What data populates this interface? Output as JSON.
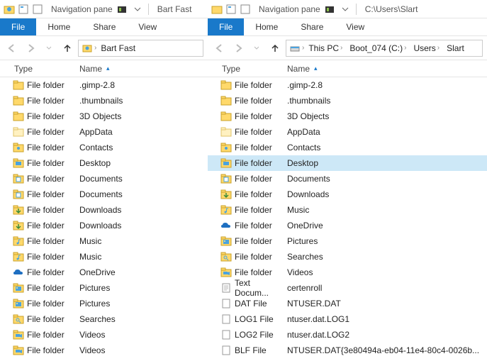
{
  "left": {
    "title_prefix": "Navigation pane",
    "title_path": "Bart Fast",
    "tabs": {
      "file": "File",
      "home": "Home",
      "share": "Share",
      "view": "View"
    },
    "breadcrumb": [
      "Bart Fast"
    ],
    "columns": {
      "type": "Type",
      "name": "Name"
    },
    "rows": [
      {
        "icon": "folder",
        "type": "File folder",
        "name": ".gimp-2.8"
      },
      {
        "icon": "folder",
        "type": "File folder",
        "name": ".thumbnails"
      },
      {
        "icon": "folder",
        "type": "File folder",
        "name": "3D Objects"
      },
      {
        "icon": "folder-light",
        "type": "File folder",
        "name": "AppData"
      },
      {
        "icon": "contacts",
        "type": "File folder",
        "name": "Contacts"
      },
      {
        "icon": "desktop",
        "type": "File folder",
        "name": "Desktop"
      },
      {
        "icon": "documents",
        "type": "File folder",
        "name": "Documents"
      },
      {
        "icon": "documents",
        "type": "File folder",
        "name": "Documents"
      },
      {
        "icon": "downloads",
        "type": "File folder",
        "name": "Downloads"
      },
      {
        "icon": "downloads",
        "type": "File folder",
        "name": "Downloads"
      },
      {
        "icon": "music",
        "type": "File folder",
        "name": "Music"
      },
      {
        "icon": "music",
        "type": "File folder",
        "name": "Music"
      },
      {
        "icon": "onedrive",
        "type": "File folder",
        "name": "OneDrive"
      },
      {
        "icon": "pictures",
        "type": "File folder",
        "name": "Pictures"
      },
      {
        "icon": "pictures",
        "type": "File folder",
        "name": "Pictures"
      },
      {
        "icon": "searches",
        "type": "File folder",
        "name": "Searches"
      },
      {
        "icon": "videos",
        "type": "File folder",
        "name": "Videos"
      },
      {
        "icon": "videos",
        "type": "File folder",
        "name": "Videos"
      }
    ]
  },
  "right": {
    "title_prefix": "Navigation pane",
    "title_path": "C:\\Users\\Slart",
    "tabs": {
      "file": "File",
      "home": "Home",
      "share": "Share",
      "view": "View"
    },
    "breadcrumb": [
      "This PC",
      "Boot_074 (C:)",
      "Users",
      "Slart"
    ],
    "columns": {
      "type": "Type",
      "name": "Name"
    },
    "selected_index": 5,
    "rows": [
      {
        "icon": "folder",
        "type": "File folder",
        "name": ".gimp-2.8"
      },
      {
        "icon": "folder",
        "type": "File folder",
        "name": ".thumbnails"
      },
      {
        "icon": "folder",
        "type": "File folder",
        "name": "3D Objects"
      },
      {
        "icon": "folder-light",
        "type": "File folder",
        "name": "AppData"
      },
      {
        "icon": "contacts",
        "type": "File folder",
        "name": "Contacts"
      },
      {
        "icon": "desktop",
        "type": "File folder",
        "name": "Desktop"
      },
      {
        "icon": "documents",
        "type": "File folder",
        "name": "Documents"
      },
      {
        "icon": "downloads",
        "type": "File folder",
        "name": "Downloads"
      },
      {
        "icon": "music",
        "type": "File folder",
        "name": "Music"
      },
      {
        "icon": "onedrive",
        "type": "File folder",
        "name": "OneDrive"
      },
      {
        "icon": "pictures",
        "type": "File folder",
        "name": "Pictures"
      },
      {
        "icon": "searches",
        "type": "File folder",
        "name": "Searches"
      },
      {
        "icon": "videos",
        "type": "File folder",
        "name": "Videos"
      },
      {
        "icon": "text",
        "type": "Text Docum...",
        "name": "certenroll"
      },
      {
        "icon": "file",
        "type": "DAT File",
        "name": "NTUSER.DAT"
      },
      {
        "icon": "file",
        "type": "LOG1 File",
        "name": "ntuser.dat.LOG1"
      },
      {
        "icon": "file",
        "type": "LOG2 File",
        "name": "ntuser.dat.LOG2"
      },
      {
        "icon": "file",
        "type": "BLF File",
        "name": "NTUSER.DAT{3e80494a-eb04-11e4-80c4-0026b..."
      }
    ]
  }
}
